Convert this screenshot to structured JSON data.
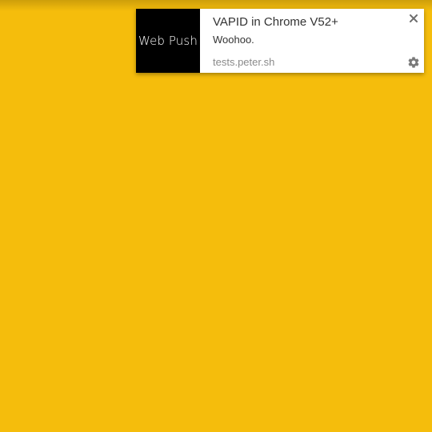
{
  "colors": {
    "page_background": "#f5bd0c",
    "notification_background": "#ffffff",
    "icon_background": "#000000",
    "icon_text": "#ffffff",
    "title_text": "#333333",
    "origin_text": "#8a8a8a",
    "control_icons": "#6e6e6e"
  },
  "notification": {
    "icon_label": "Web Push",
    "title": "VAPID in Chrome V52+",
    "body": "Woohoo.",
    "origin": "tests.peter.sh",
    "close_icon": "close-icon",
    "settings_icon": "gear-icon"
  }
}
